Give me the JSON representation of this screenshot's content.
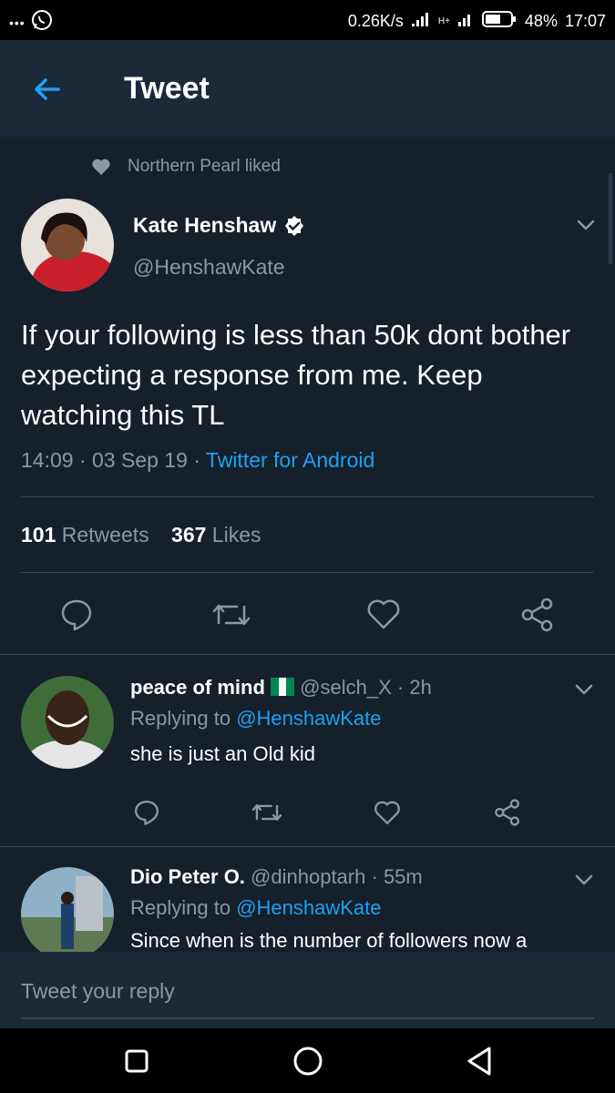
{
  "status_bar": {
    "dots": "•••",
    "network_speed": "0.26K/s",
    "network_type": "H+",
    "battery": "48%",
    "time": "17:07"
  },
  "header": {
    "title": "Tweet"
  },
  "social_context": {
    "text": "Northern Pearl liked"
  },
  "tweet": {
    "author_name": "Kate Henshaw",
    "handle": "@HenshawKate",
    "text": "If your following is less than 50k dont bother expecting a response from me. Keep watching this TL",
    "time": "14:09",
    "date": "03 Sep 19",
    "source": "Twitter for Android",
    "retweets_count": "101",
    "retweets_label": "Retweets",
    "likes_count": "367",
    "likes_label": "Likes"
  },
  "replies": [
    {
      "name": "peace of mind",
      "handle": "@selch_X",
      "time": "2h",
      "replying_label": "Replying to",
      "replying_to": "@HenshawKate",
      "text": "she is just an Old kid"
    },
    {
      "name": "Dio Peter O.",
      "handle": "@dinhoptarh",
      "time": "55m",
      "replying_label": "Replying to",
      "replying_to": "@HenshawKate",
      "text": "Since when is the number of followers now a"
    }
  ],
  "composer": {
    "placeholder": "Tweet your reply"
  },
  "colors": {
    "background": "#15202b",
    "accent": "#1da1f2",
    "muted": "#8899a6"
  }
}
